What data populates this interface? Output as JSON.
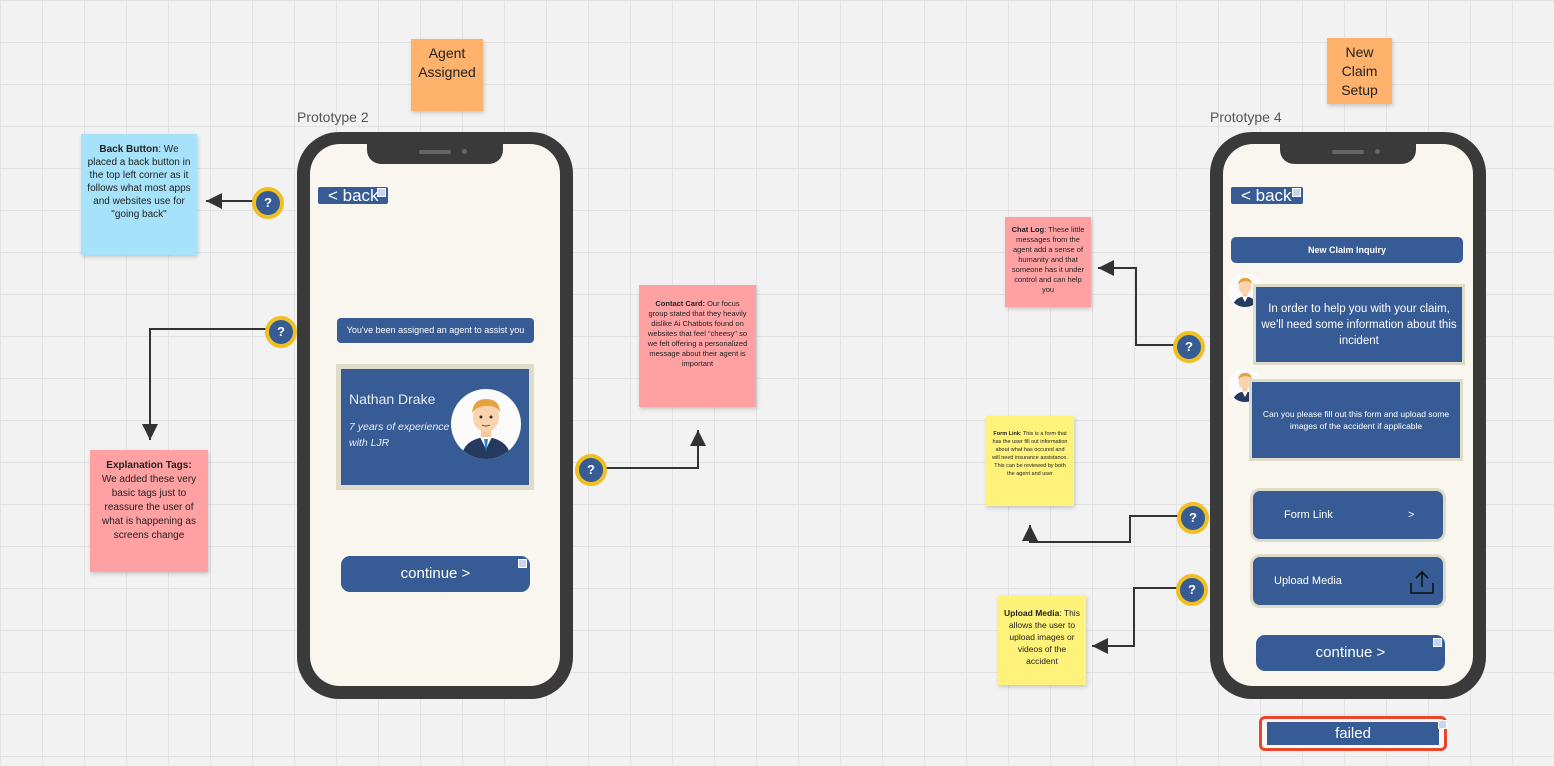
{
  "stickies": {
    "agent_assigned": "Agent Assigned",
    "new_claim_setup": "New Claim Setup",
    "back_button_title": "Back Button",
    "back_button_body": ": We placed a back button in the top left corner as it follows what most apps and websites use for \"going back\"",
    "explanation_title": "Explanation Tags:",
    "explanation_body": "We added these very basic tags just to reassure the user of what is happening as screens change",
    "contact_card_title": "Contact Card:",
    "contact_card_body": " Our focus group stated that they heavily dislike Ai Chatbots found on websites that feel \"cheesy\" so we felt offering a personalized message about their agent is important",
    "chat_log_title": "Chat Log",
    "chat_log_body": ": These little messages from the agent add a sense of humanity and that someone has it under control and can help you",
    "form_link_title": "Form Link",
    "form_link_body": ": This is a form that has the user fill out information about what has occured and will need insurance assistance. This can be reviewed by both the agent and user",
    "upload_media_title": "Upload Media",
    "upload_media_body": ": This allows the user to upload images or videos of the accident"
  },
  "prototype2": {
    "label": "Prototype 2",
    "back": "< back",
    "tag": "You've been assigned an agent to assist you",
    "agent_name": "Nathan Drake",
    "agent_exp": "7 years of experience with LJR",
    "continue": "continue >"
  },
  "prototype4": {
    "label": "Prototype 4",
    "back": "< back",
    "header": "New Claim Inquiry",
    "msg1": "In order to help you with your claim, we'll need some information about this incident",
    "msg2": "Can you please fill out this form and upload some images of the accident if applicable",
    "form_link": "Form Link",
    "form_link_chevron": ">",
    "upload_media": "Upload Media",
    "continue": "continue >",
    "failed": "failed"
  },
  "help_mark": "?",
  "colors": {
    "navy": "#365b95",
    "orange_sticky": "#ffb26b",
    "blue_sticky": "#a6e3fa",
    "pink_sticky": "#ffa0a3",
    "yellow_sticky": "#fff27a",
    "help_ring": "#f0c022",
    "failed_border": "#e8462a"
  },
  "icons": [
    "question-mark-icon",
    "upload-icon",
    "expand-icon",
    "agent-avatar"
  ]
}
